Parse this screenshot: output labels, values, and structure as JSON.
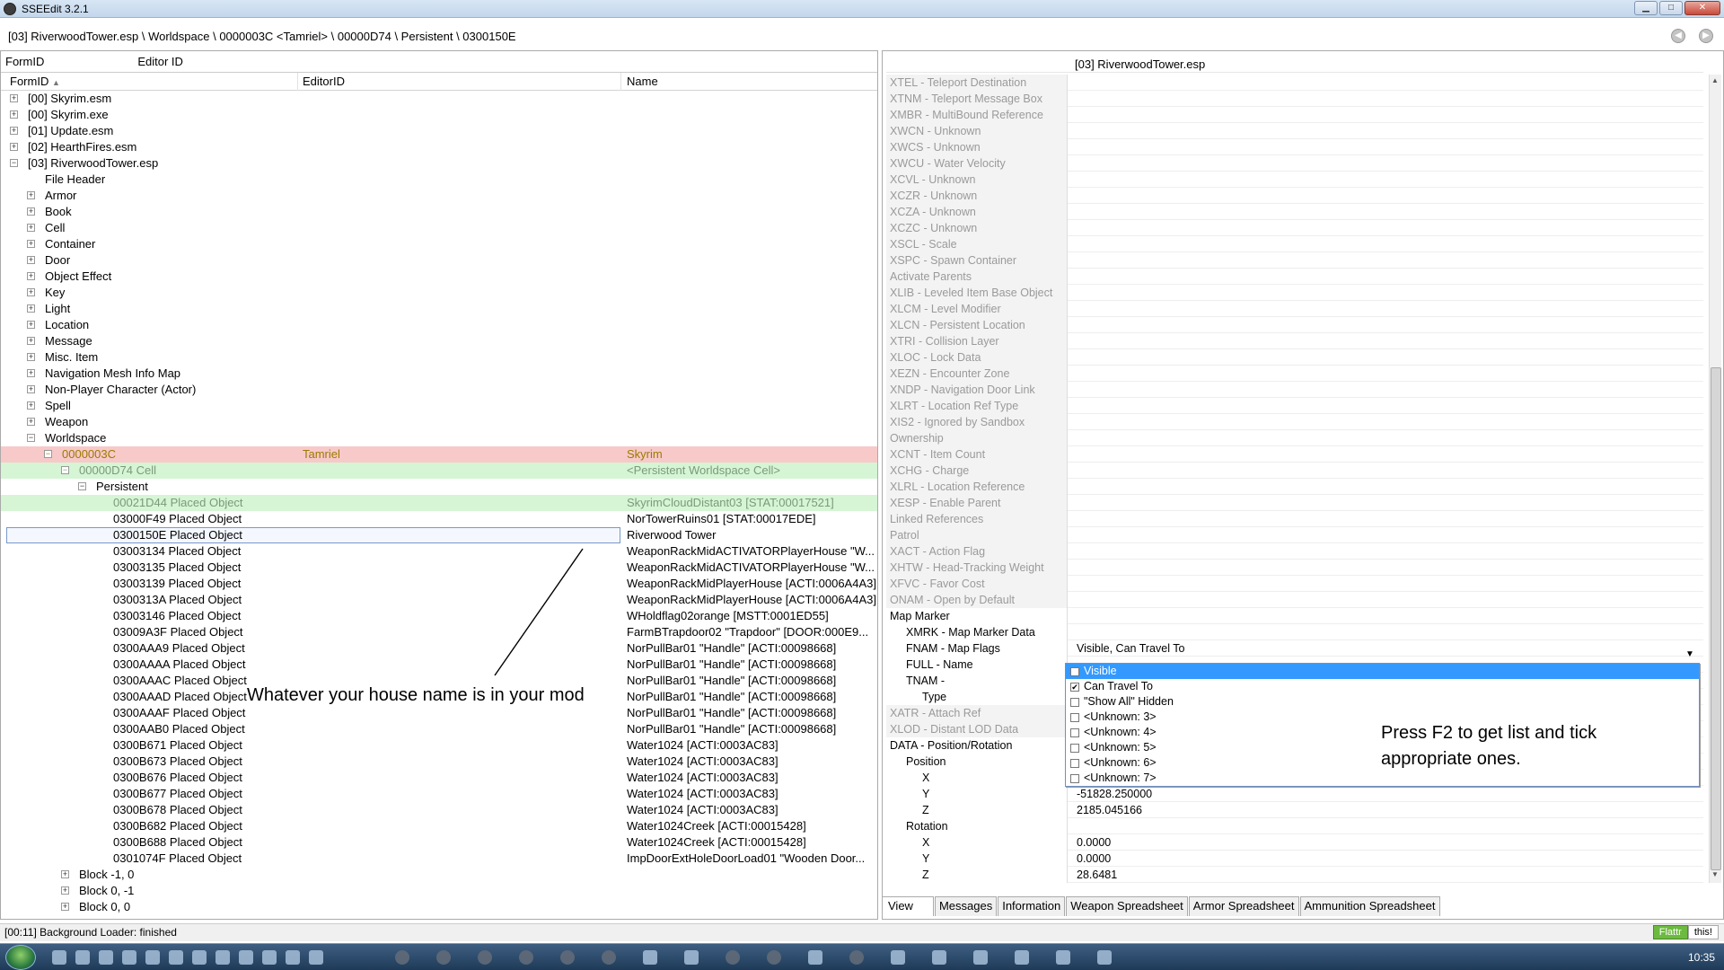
{
  "window": {
    "title": "SSEEdit 3.2.1"
  },
  "path": "[03] RiverwoodTower.esp \\ Worldspace \\ 0000003C <Tamriel> \\ 00000D74 \\ Persistent \\ 0300150E",
  "filter": {
    "formid_label": "FormID",
    "editorid_label": "Editor ID"
  },
  "tree": {
    "headers": {
      "formid": "FormID",
      "editorid": "EditorID",
      "name": "Name"
    },
    "rows": [
      {
        "id": "[00] Skyrim.esm",
        "ed": "",
        "name": "",
        "level": 0,
        "exp": "+",
        "style": ""
      },
      {
        "id": "[00] Skyrim.exe",
        "ed": "",
        "name": "",
        "level": 0,
        "exp": "+",
        "style": ""
      },
      {
        "id": "[01] Update.esm",
        "ed": "",
        "name": "",
        "level": 0,
        "exp": "+",
        "style": ""
      },
      {
        "id": "[02] HearthFires.esm",
        "ed": "",
        "name": "",
        "level": 0,
        "exp": "+",
        "style": ""
      },
      {
        "id": "[03] RiverwoodTower.esp",
        "ed": "",
        "name": "",
        "level": 0,
        "exp": "-",
        "style": ""
      },
      {
        "id": "File Header",
        "ed": "",
        "name": "",
        "level": 1,
        "exp": "",
        "style": ""
      },
      {
        "id": "Armor",
        "ed": "",
        "name": "",
        "level": 1,
        "exp": "+",
        "style": ""
      },
      {
        "id": "Book",
        "ed": "",
        "name": "",
        "level": 1,
        "exp": "+",
        "style": ""
      },
      {
        "id": "Cell",
        "ed": "",
        "name": "",
        "level": 1,
        "exp": "+",
        "style": ""
      },
      {
        "id": "Container",
        "ed": "",
        "name": "",
        "level": 1,
        "exp": "+",
        "style": ""
      },
      {
        "id": "Door",
        "ed": "",
        "name": "",
        "level": 1,
        "exp": "+",
        "style": ""
      },
      {
        "id": "Object Effect",
        "ed": "",
        "name": "",
        "level": 1,
        "exp": "+",
        "style": ""
      },
      {
        "id": "Key",
        "ed": "",
        "name": "",
        "level": 1,
        "exp": "+",
        "style": ""
      },
      {
        "id": "Light",
        "ed": "",
        "name": "",
        "level": 1,
        "exp": "+",
        "style": ""
      },
      {
        "id": "Location",
        "ed": "",
        "name": "",
        "level": 1,
        "exp": "+",
        "style": ""
      },
      {
        "id": "Message",
        "ed": "",
        "name": "",
        "level": 1,
        "exp": "+",
        "style": ""
      },
      {
        "id": "Misc. Item",
        "ed": "",
        "name": "",
        "level": 1,
        "exp": "+",
        "style": ""
      },
      {
        "id": "Navigation Mesh Info Map",
        "ed": "",
        "name": "",
        "level": 1,
        "exp": "+",
        "style": ""
      },
      {
        "id": "Non-Player Character (Actor)",
        "ed": "",
        "name": "",
        "level": 1,
        "exp": "+",
        "style": ""
      },
      {
        "id": "Spell",
        "ed": "",
        "name": "",
        "level": 1,
        "exp": "+",
        "style": ""
      },
      {
        "id": "Weapon",
        "ed": "",
        "name": "",
        "level": 1,
        "exp": "+",
        "style": ""
      },
      {
        "id": "Worldspace",
        "ed": "",
        "name": "",
        "level": 1,
        "exp": "-",
        "style": ""
      },
      {
        "id": "0000003C",
        "ed": "Tamriel",
        "name": "Skyrim",
        "level": 2,
        "exp": "-",
        "style": "hl-red"
      },
      {
        "id": "00000D74  Cell",
        "ed": "",
        "name": "<Persistent Worldspace Cell>",
        "level": 3,
        "exp": "-",
        "style": "hl-green"
      },
      {
        "id": "Persistent",
        "ed": "",
        "name": "",
        "level": 4,
        "exp": "-",
        "style": ""
      },
      {
        "id": "00021D44  Placed Object",
        "ed": "",
        "name": "SkyrimCloudDistant03 [STAT:00017521]",
        "level": 5,
        "exp": "",
        "style": "hl-green"
      },
      {
        "id": "03000F49  Placed Object",
        "ed": "",
        "name": "NorTowerRuins01 [STAT:00017EDE]",
        "level": 5,
        "exp": "",
        "style": ""
      },
      {
        "id": "0300150E  Placed Object",
        "ed": "",
        "name": "Riverwood Tower",
        "level": 5,
        "exp": "",
        "style": "sel"
      },
      {
        "id": "03003134  Placed Object",
        "ed": "",
        "name": "WeaponRackMidACTIVATORPlayerHouse \"W...",
        "level": 5,
        "exp": "",
        "style": ""
      },
      {
        "id": "03003135  Placed Object",
        "ed": "",
        "name": "WeaponRackMidACTIVATORPlayerHouse \"W...",
        "level": 5,
        "exp": "",
        "style": ""
      },
      {
        "id": "03003139  Placed Object",
        "ed": "",
        "name": "WeaponRackMidPlayerHouse [ACTI:0006A4A3]",
        "level": 5,
        "exp": "",
        "style": ""
      },
      {
        "id": "0300313A  Placed Object",
        "ed": "",
        "name": "WeaponRackMidPlayerHouse [ACTI:0006A4A3]",
        "level": 5,
        "exp": "",
        "style": ""
      },
      {
        "id": "03003146  Placed Object",
        "ed": "",
        "name": "WHoldflag02orange [MSTT:0001ED55]",
        "level": 5,
        "exp": "",
        "style": ""
      },
      {
        "id": "03009A3F  Placed Object",
        "ed": "",
        "name": "FarmBTrapdoor02 \"Trapdoor\" [DOOR:000E9...",
        "level": 5,
        "exp": "",
        "style": ""
      },
      {
        "id": "0300AAA9  Placed Object",
        "ed": "",
        "name": "NorPullBar01 \"Handle\" [ACTI:00098668]",
        "level": 5,
        "exp": "",
        "style": ""
      },
      {
        "id": "0300AAAA  Placed Object",
        "ed": "",
        "name": "NorPullBar01 \"Handle\" [ACTI:00098668]",
        "level": 5,
        "exp": "",
        "style": ""
      },
      {
        "id": "0300AAAC  Placed Object",
        "ed": "",
        "name": "NorPullBar01 \"Handle\" [ACTI:00098668]",
        "level": 5,
        "exp": "",
        "style": ""
      },
      {
        "id": "0300AAAD  Placed Object",
        "ed": "",
        "name": "NorPullBar01 \"Handle\" [ACTI:00098668]",
        "level": 5,
        "exp": "",
        "style": ""
      },
      {
        "id": "0300AAAF  Placed Object",
        "ed": "",
        "name": "NorPullBar01 \"Handle\" [ACTI:00098668]",
        "level": 5,
        "exp": "",
        "style": ""
      },
      {
        "id": "0300AAB0  Placed Object",
        "ed": "",
        "name": "NorPullBar01 \"Handle\" [ACTI:00098668]",
        "level": 5,
        "exp": "",
        "style": ""
      },
      {
        "id": "0300B671  Placed Object",
        "ed": "",
        "name": "Water1024 [ACTI:0003AC83]",
        "level": 5,
        "exp": "",
        "style": ""
      },
      {
        "id": "0300B673  Placed Object",
        "ed": "",
        "name": "Water1024 [ACTI:0003AC83]",
        "level": 5,
        "exp": "",
        "style": ""
      },
      {
        "id": "0300B676  Placed Object",
        "ed": "",
        "name": "Water1024 [ACTI:0003AC83]",
        "level": 5,
        "exp": "",
        "style": ""
      },
      {
        "id": "0300B677  Placed Object",
        "ed": "",
        "name": "Water1024 [ACTI:0003AC83]",
        "level": 5,
        "exp": "",
        "style": ""
      },
      {
        "id": "0300B678  Placed Object",
        "ed": "",
        "name": "Water1024 [ACTI:0003AC83]",
        "level": 5,
        "exp": "",
        "style": ""
      },
      {
        "id": "0300B682  Placed Object",
        "ed": "",
        "name": "Water1024Creek [ACTI:00015428]",
        "level": 5,
        "exp": "",
        "style": ""
      },
      {
        "id": "0300B688  Placed Object",
        "ed": "",
        "name": "Water1024Creek [ACTI:00015428]",
        "level": 5,
        "exp": "",
        "style": ""
      },
      {
        "id": "0301074F  Placed Object",
        "ed": "",
        "name": "ImpDoorExtHoleDoorLoad01 \"Wooden Door...",
        "level": 5,
        "exp": "",
        "style": ""
      },
      {
        "id": "Block -1, 0",
        "ed": "",
        "name": "",
        "level": 3,
        "exp": "+",
        "style": ""
      },
      {
        "id": "Block 0, -1",
        "ed": "",
        "name": "",
        "level": 3,
        "exp": "+",
        "style": ""
      },
      {
        "id": "Block 0, 0",
        "ed": "",
        "name": "",
        "level": 3,
        "exp": "+",
        "style": ""
      }
    ]
  },
  "annotation_left": "Whatever your house name is in your mod",
  "record": {
    "header": "[03] RiverwoodTower.esp",
    "rows": [
      {
        "label": "XTEL - Teleport Destination",
        "value": "",
        "active": false,
        "indent": 0
      },
      {
        "label": "XTNM - Teleport Message Box",
        "value": "",
        "active": false,
        "indent": 0
      },
      {
        "label": "XMBR - MultiBound Reference",
        "value": "",
        "active": false,
        "indent": 0
      },
      {
        "label": "XWCN - Unknown",
        "value": "",
        "active": false,
        "indent": 0
      },
      {
        "label": "XWCS - Unknown",
        "value": "",
        "active": false,
        "indent": 0
      },
      {
        "label": "XWCU - Water Velocity",
        "value": "",
        "active": false,
        "indent": 0
      },
      {
        "label": "XCVL - Unknown",
        "value": "",
        "active": false,
        "indent": 0
      },
      {
        "label": "XCZR - Unknown",
        "value": "",
        "active": false,
        "indent": 0
      },
      {
        "label": "XCZA - Unknown",
        "value": "",
        "active": false,
        "indent": 0
      },
      {
        "label": "XCZC - Unknown",
        "value": "",
        "active": false,
        "indent": 0
      },
      {
        "label": "XSCL - Scale",
        "value": "",
        "active": false,
        "indent": 0
      },
      {
        "label": "XSPC - Spawn Container",
        "value": "",
        "active": false,
        "indent": 0
      },
      {
        "label": "Activate Parents",
        "value": "",
        "active": false,
        "indent": 0
      },
      {
        "label": "XLIB - Leveled Item Base Object",
        "value": "",
        "active": false,
        "indent": 0
      },
      {
        "label": "XLCM - Level Modifier",
        "value": "",
        "active": false,
        "indent": 0
      },
      {
        "label": "XLCN - Persistent Location",
        "value": "",
        "active": false,
        "indent": 0
      },
      {
        "label": "XTRI - Collision Layer",
        "value": "",
        "active": false,
        "indent": 0
      },
      {
        "label": "XLOC - Lock Data",
        "value": "",
        "active": false,
        "indent": 0
      },
      {
        "label": "XEZN - Encounter Zone",
        "value": "",
        "active": false,
        "indent": 0
      },
      {
        "label": "XNDP - Navigation Door Link",
        "value": "",
        "active": false,
        "indent": 0
      },
      {
        "label": "XLRT - Location Ref Type",
        "value": "",
        "active": false,
        "indent": 0
      },
      {
        "label": "XIS2 - Ignored by Sandbox",
        "value": "",
        "active": false,
        "indent": 0
      },
      {
        "label": "Ownership",
        "value": "",
        "active": false,
        "indent": 0
      },
      {
        "label": "XCNT - Item Count",
        "value": "",
        "active": false,
        "indent": 0
      },
      {
        "label": "XCHG - Charge",
        "value": "",
        "active": false,
        "indent": 0
      },
      {
        "label": "XLRL - Location Reference",
        "value": "",
        "active": false,
        "indent": 0
      },
      {
        "label": "XESP - Enable Parent",
        "value": "",
        "active": false,
        "indent": 0
      },
      {
        "label": "Linked References",
        "value": "",
        "active": false,
        "indent": 0
      },
      {
        "label": "Patrol",
        "value": "",
        "active": false,
        "indent": 0
      },
      {
        "label": "XACT - Action Flag",
        "value": "",
        "active": false,
        "indent": 0
      },
      {
        "label": "XHTW - Head-Tracking Weight",
        "value": "",
        "active": false,
        "indent": 0
      },
      {
        "label": "XFVC - Favor Cost",
        "value": "",
        "active": false,
        "indent": 0
      },
      {
        "label": "ONAM - Open by Default",
        "value": "",
        "active": false,
        "indent": 0
      },
      {
        "label": "Map Marker",
        "value": "",
        "active": true,
        "indent": 0
      },
      {
        "label": "XMRK - Map Marker Data",
        "value": "",
        "active": true,
        "indent": 1
      },
      {
        "label": "FNAM - Map Flags",
        "value": "Visible, Can Travel To",
        "active": true,
        "indent": 1
      },
      {
        "label": "FULL - Name",
        "value": "",
        "active": true,
        "indent": 1
      },
      {
        "label": "TNAM -",
        "value": "",
        "active": true,
        "indent": 1
      },
      {
        "label": "Type",
        "value": "",
        "active": true,
        "indent": 2
      },
      {
        "label": "XATR - Attach Ref",
        "value": "",
        "active": false,
        "indent": 0
      },
      {
        "label": "XLOD - Distant LOD Data",
        "value": "",
        "active": false,
        "indent": 0
      },
      {
        "label": "DATA - Position/Rotation",
        "value": "",
        "active": true,
        "indent": 0
      },
      {
        "label": "Position",
        "value": "",
        "active": true,
        "indent": 1
      },
      {
        "label": "X",
        "value": "",
        "active": true,
        "indent": 2
      },
      {
        "label": "Y",
        "value": "-51828.250000",
        "active": true,
        "indent": 2
      },
      {
        "label": "Z",
        "value": "2185.045166",
        "active": true,
        "indent": 2
      },
      {
        "label": "Rotation",
        "value": "",
        "active": true,
        "indent": 1
      },
      {
        "label": "X",
        "value": "0.0000",
        "active": true,
        "indent": 2
      },
      {
        "label": "Y",
        "value": "0.0000",
        "active": true,
        "indent": 2
      },
      {
        "label": "Z",
        "value": "28.6481",
        "active": true,
        "indent": 2
      }
    ]
  },
  "flags": [
    {
      "label": "Visible",
      "checked": true,
      "selected": true
    },
    {
      "label": "Can Travel To",
      "checked": true,
      "selected": false
    },
    {
      "label": "\"Show All\" Hidden",
      "checked": false,
      "selected": false
    },
    {
      "label": "<Unknown: 3>",
      "checked": false,
      "selected": false
    },
    {
      "label": "<Unknown: 4>",
      "checked": false,
      "selected": false
    },
    {
      "label": "<Unknown: 5>",
      "checked": false,
      "selected": false
    },
    {
      "label": "<Unknown: 6>",
      "checked": false,
      "selected": false
    },
    {
      "label": "<Unknown: 7>",
      "checked": false,
      "selected": false
    }
  ],
  "annotation_right": "Press F2 to get list and tick appropriate ones.",
  "tabs": [
    "View",
    "Messages",
    "Information",
    "Weapon Spreadsheet",
    "Armor Spreadsheet",
    "Ammunition Spreadsheet"
  ],
  "status": "[00:11] Background Loader: finished",
  "flattr": {
    "left": "Flattr",
    "right": "this!"
  },
  "clock": "10:35"
}
